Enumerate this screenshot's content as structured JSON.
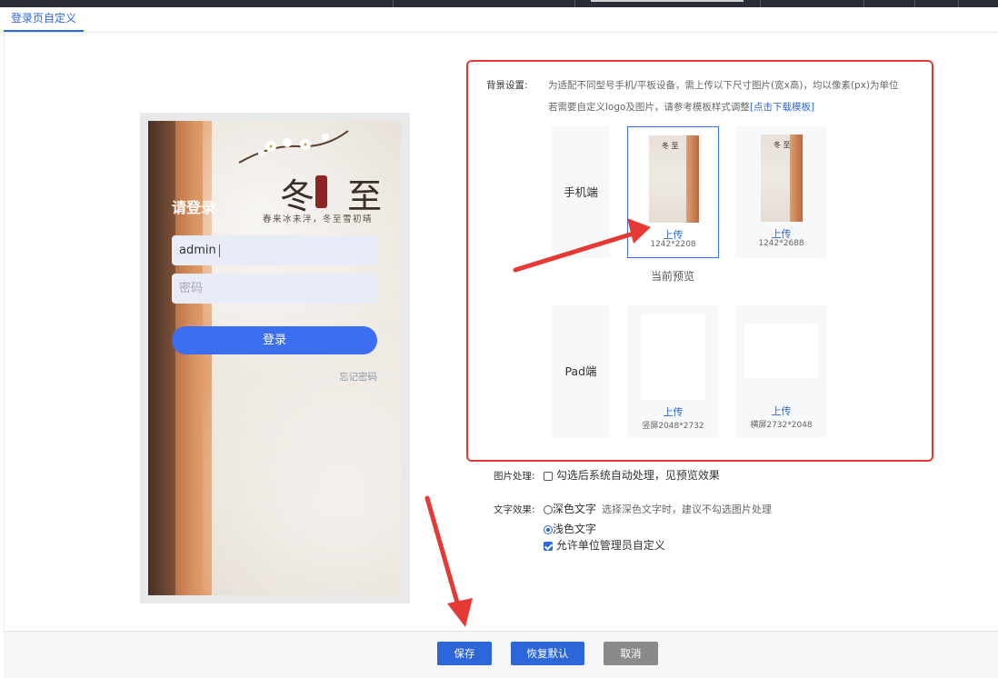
{
  "tab": {
    "label": "登录页自定义"
  },
  "preview_phone": {
    "title": "请登录",
    "calligraphy": "冬 至",
    "subline": "春来冰未泮，冬至雪初晴",
    "username_value": "admin",
    "password_placeholder": "密码",
    "login_button": "登录",
    "forgot_link": "忘记密码"
  },
  "background": {
    "label": "背景设置:",
    "hint1": "为适配不同型号手机/平板设备，需上传以下尺寸图片(宽x高)，均以像素(px)为单位",
    "hint2": "若需要自定义logo及图片，请参考模板样式调整",
    "hint2_link": "[点击下载模板]",
    "mobile_label": "手机端",
    "pad_label": "Pad端",
    "current_preview": "当前预览",
    "mobile_cards": [
      {
        "upload": "上传",
        "size": "1242*2208",
        "selected": true
      },
      {
        "upload": "上传",
        "size": "1242*2688",
        "selected": false
      }
    ],
    "pad_cards": [
      {
        "upload": "上传",
        "size": "竖屏2048*2732"
      },
      {
        "upload": "上传",
        "size": "横屏2732*2048"
      }
    ]
  },
  "image_processing": {
    "label": "图片处理:",
    "option": "勾选后系统自动处理，见预览效果",
    "checked": false
  },
  "text_effect": {
    "label": "文字效果:",
    "dark": "深色文字",
    "dark_note": "选择深色文字时，建议不勾选图片处理",
    "light": "浅色文字",
    "selected": "light"
  },
  "allow_admin": {
    "label": "允许单位管理员自定义",
    "checked": true
  },
  "footer": {
    "save": "保存",
    "reset": "恢复默认",
    "cancel": "取消"
  },
  "colors": {
    "accent": "#2c66d8",
    "annotation": "#e53935",
    "cancel": "#8a8a8a"
  }
}
